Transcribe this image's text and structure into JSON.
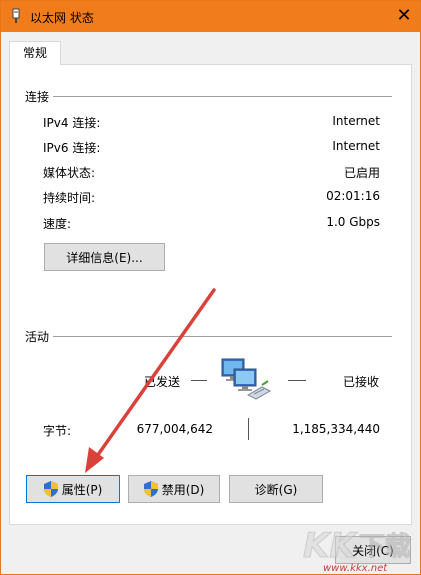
{
  "window": {
    "title": "以太网 状态",
    "close_glyph": "✕"
  },
  "tabs": [
    {
      "label": "常规"
    }
  ],
  "connection": {
    "title": "连接",
    "rows": [
      {
        "label": "IPv4 连接:",
        "value": "Internet"
      },
      {
        "label": "IPv6 连接:",
        "value": "Internet"
      },
      {
        "label": "媒体状态:",
        "value": "已启用"
      },
      {
        "label": "持续时间:",
        "value": "02:01:16"
      },
      {
        "label": "速度:",
        "value": "1.0 Gbps"
      }
    ],
    "details_button": "详细信息(E)..."
  },
  "activity": {
    "title": "活动",
    "sent_label": "已发送",
    "received_label": "已接收",
    "bytes_label": "字节:",
    "bytes_sent": "677,004,642",
    "bytes_received": "1,185,334,440"
  },
  "buttons": {
    "properties": "属性(P)",
    "disable": "禁用(D)",
    "diagnose": "诊断(G)",
    "close": "关闭(C)"
  },
  "watermark": {
    "logo_text": "KK下载",
    "url": "www.kkx.net"
  },
  "colors": {
    "titlebar": "#f07c1c",
    "arrow": "#d9423a",
    "accent_border": "#0078d7"
  }
}
